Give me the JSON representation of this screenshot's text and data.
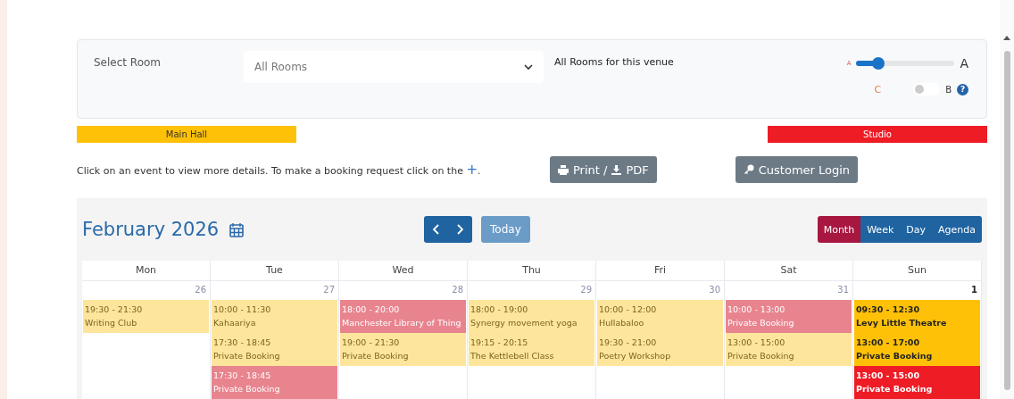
{
  "room_filter": {
    "label": "Select Room",
    "select": {
      "value": "All Rooms"
    },
    "description": "All Rooms for this venue"
  },
  "text_size": {
    "small_label": "A",
    "large_label": "A",
    "level": 0.22
  },
  "contrast": {
    "left_label": "C",
    "right_label": "B",
    "on": false,
    "help": "?"
  },
  "rooms": [
    {
      "name": "Main Hall",
      "color": "#ffc107"
    },
    {
      "name": "Studio",
      "color": "#ee1c25"
    }
  ],
  "instructions": "Click on an event to view more details. To make a booking request click on the",
  "instructions_plus": "+",
  "instructions_end": ".",
  "print_button": {
    "print": "Print /",
    "pdf": "PDF"
  },
  "login_button": "Customer Login",
  "calendar": {
    "title": "February 2026",
    "today": "Today",
    "views": [
      {
        "label": "Month",
        "selected": true
      },
      {
        "label": "Week",
        "selected": false
      },
      {
        "label": "Day",
        "selected": false
      },
      {
        "label": "Agenda",
        "selected": false
      }
    ],
    "weekdays": [
      "Mon",
      "Tue",
      "Wed",
      "Thu",
      "Fri",
      "Sat",
      "Sun"
    ],
    "days": [
      {
        "number": "26",
        "past": true,
        "events": [
          {
            "time": "19:30 - 21:30",
            "title": "Writing Club",
            "kind": "main_hall"
          }
        ]
      },
      {
        "number": "27",
        "past": true,
        "events": [
          {
            "time": "10:00 - 11:30",
            "title": "Kahaariya",
            "kind": "main_hall"
          },
          {
            "time": "17:30 - 18:45",
            "title": "Private Booking",
            "kind": "main_hall"
          },
          {
            "time": "17:30 - 18:45",
            "title": "Private Booking",
            "kind": "studio"
          }
        ]
      },
      {
        "number": "28",
        "past": true,
        "events": [
          {
            "time": "18:00 - 20:00",
            "title": "Manchester Library of Thing",
            "kind": "studio"
          },
          {
            "time": "19:00 - 21:30",
            "title": "Private Booking",
            "kind": "main_hall"
          }
        ]
      },
      {
        "number": "29",
        "past": true,
        "events": [
          {
            "time": "18:00 - 19:00",
            "title": "Synergy movement yoga",
            "kind": "main_hall"
          },
          {
            "time": "19:15 - 20:15",
            "title": "The Kettlebell Class",
            "kind": "main_hall"
          }
        ]
      },
      {
        "number": "30",
        "past": true,
        "events": [
          {
            "time": "10:00 - 12:00",
            "title": "Hullabaloo",
            "kind": "main_hall"
          },
          {
            "time": "19:30 - 21:00",
            "title": "Poetry Workshop",
            "kind": "main_hall"
          }
        ]
      },
      {
        "number": "31",
        "past": true,
        "events": [
          {
            "time": "10:00 - 13:00",
            "title": "Private Booking",
            "kind": "studio"
          },
          {
            "time": "13:00 - 15:00",
            "title": "Private Booking",
            "kind": "main_hall"
          }
        ]
      },
      {
        "number": "1",
        "past": false,
        "events": [
          {
            "time": "09:30 - 12:30",
            "title": "Levy Little Theatre",
            "kind": "main_hall"
          },
          {
            "time": "13:00 - 17:00",
            "title": "Private Booking",
            "kind": "main_hall"
          },
          {
            "time": "13:00 - 15:00",
            "title": "Private Booking",
            "kind": "studio"
          }
        ]
      }
    ]
  }
}
